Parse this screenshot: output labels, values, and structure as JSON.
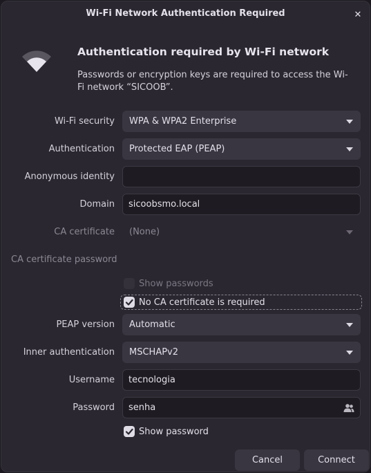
{
  "window": {
    "title": "Wi-Fi Network Authentication Required"
  },
  "header": {
    "heading": "Authentication required by Wi-Fi network",
    "description": "Passwords or encryption keys are required to access the Wi-Fi network “SICOOB”."
  },
  "form": {
    "wifi_security": {
      "label": "Wi-Fi security",
      "value": "WPA & WPA2 Enterprise"
    },
    "authentication": {
      "label": "Authentication",
      "value": "Protected EAP (PEAP)"
    },
    "anonymous_identity": {
      "label": "Anonymous identity",
      "value": ""
    },
    "domain": {
      "label": "Domain",
      "value": "sicoobsmo.local"
    },
    "ca_certificate": {
      "label": "CA certificate",
      "value": "(None)"
    },
    "ca_certificate_password": {
      "label": "CA certificate password"
    },
    "show_passwords": {
      "label": "Show passwords",
      "checked": false
    },
    "no_ca_required": {
      "label": "No CA certificate is required",
      "checked": true
    },
    "peap_version": {
      "label": "PEAP version",
      "value": "Automatic"
    },
    "inner_authentication": {
      "label": "Inner authentication",
      "value": "MSCHAPv2"
    },
    "username": {
      "label": "Username",
      "value": "tecnologia"
    },
    "password": {
      "label": "Password",
      "value": "senha"
    },
    "show_password": {
      "label": "Show password",
      "checked": true
    }
  },
  "buttons": {
    "cancel": "Cancel",
    "connect": "Connect"
  },
  "icons": {
    "close": "close-icon",
    "wifi": "wifi-icon",
    "password_storage": "people-icon",
    "dropdown": "chevron-down-icon",
    "check": "checkmark-icon"
  },
  "colors": {
    "background": "#2a2730",
    "field": "#3a3641",
    "entry": "#1e1c22",
    "text": "#e4e0ea",
    "dim_text": "#8d8894"
  }
}
